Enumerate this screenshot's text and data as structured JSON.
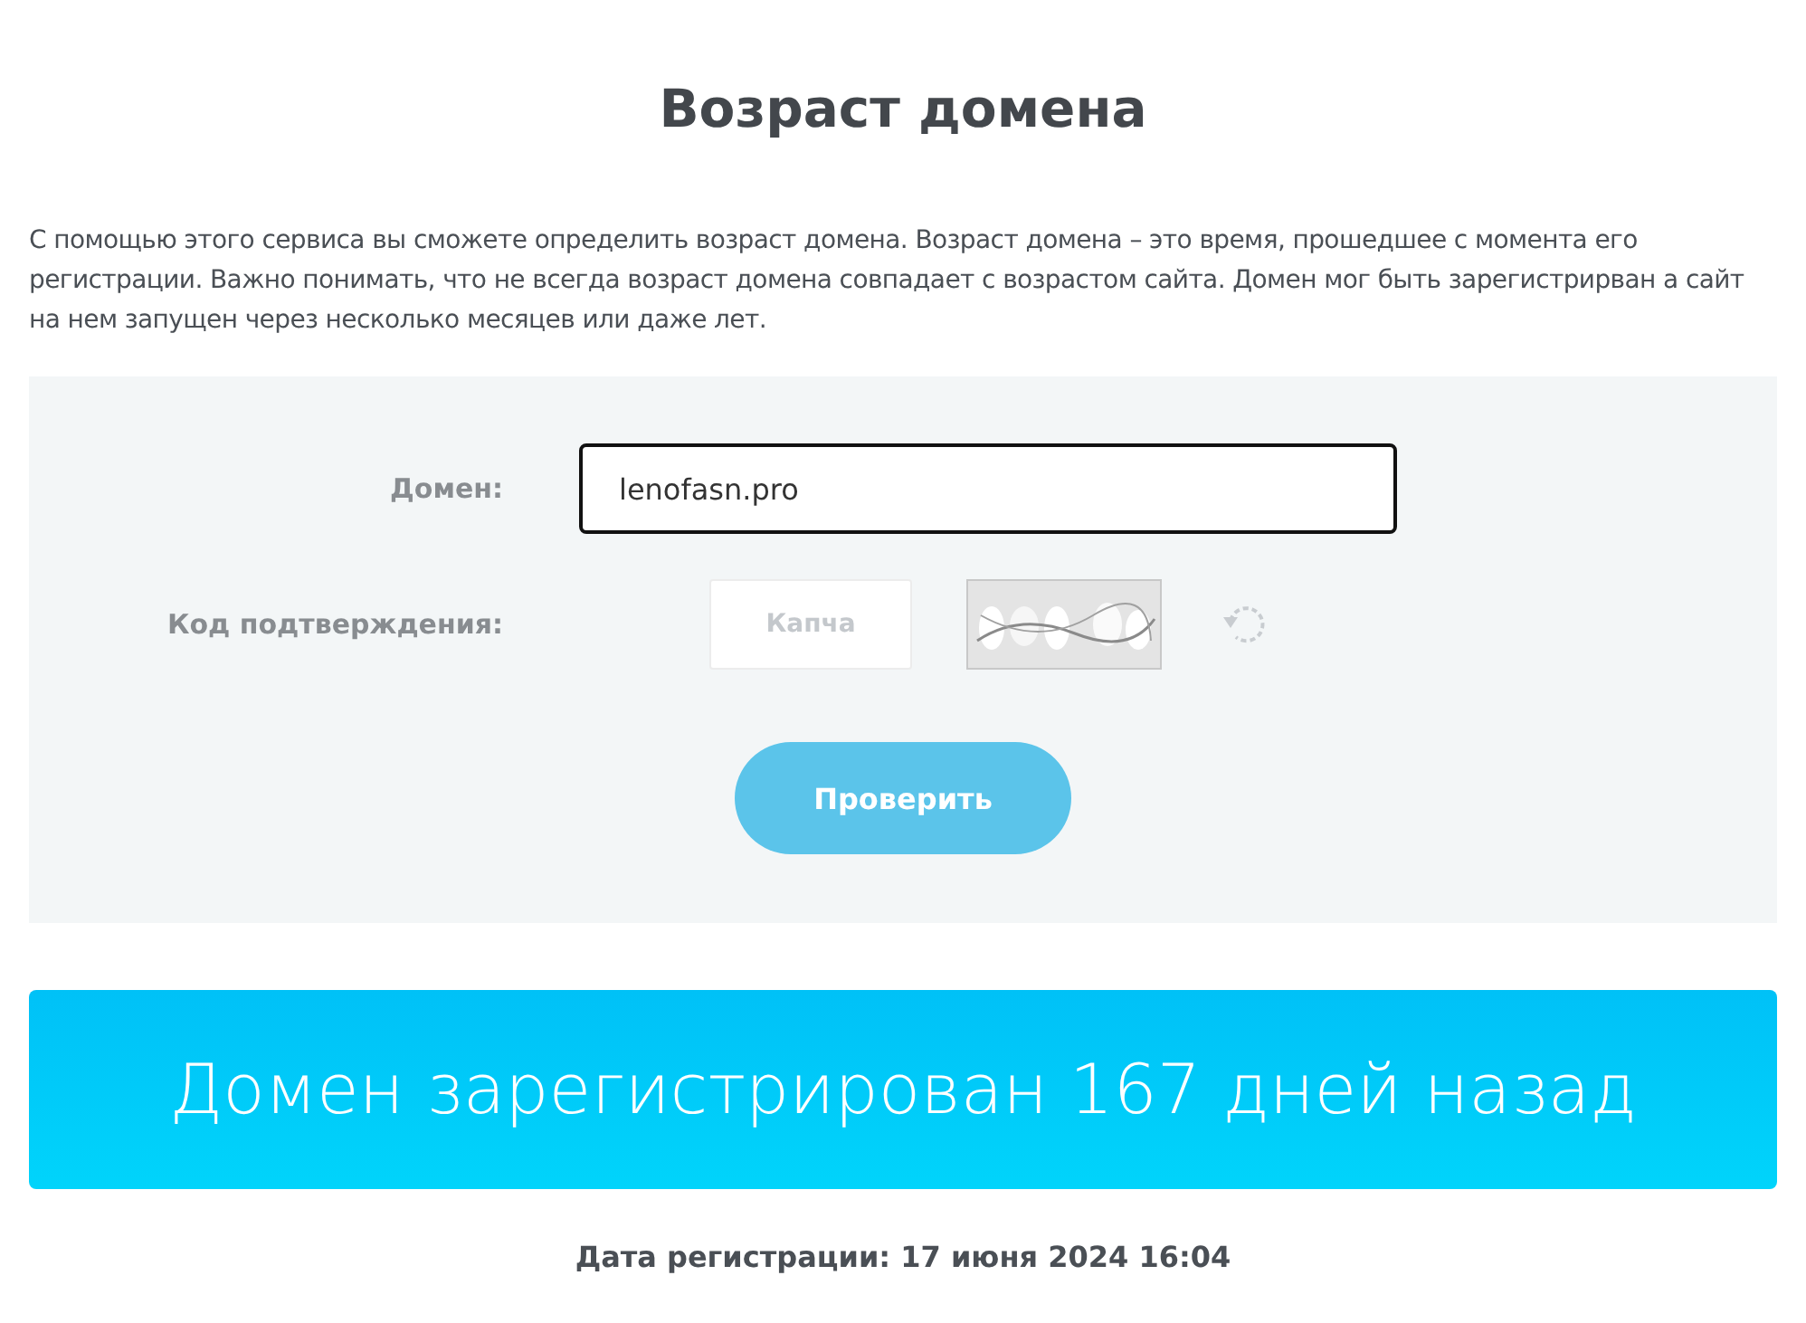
{
  "title": "Возраст домена",
  "description": "С помощью этого сервиса вы сможете определить возраст домена. Возраст домена – это время, прошедшее с момента его регистрации. Важно понимать, что не всегда возраст домена совпадает с возрастом сайта. Домен мог быть зарегистрирван а сайт на нем запущен через несколько месяцев или даже лет.",
  "form": {
    "domain_label": "Домен:",
    "domain_value": "lenofasn.pro",
    "captcha_label": "Код подтверждения:",
    "captcha_placeholder": "Капча",
    "submit": "Проверить"
  },
  "result": "Домен зарегистрирован 167 дней назад",
  "registration_date": "Дата регистрации: 17 июня 2024 16:04"
}
